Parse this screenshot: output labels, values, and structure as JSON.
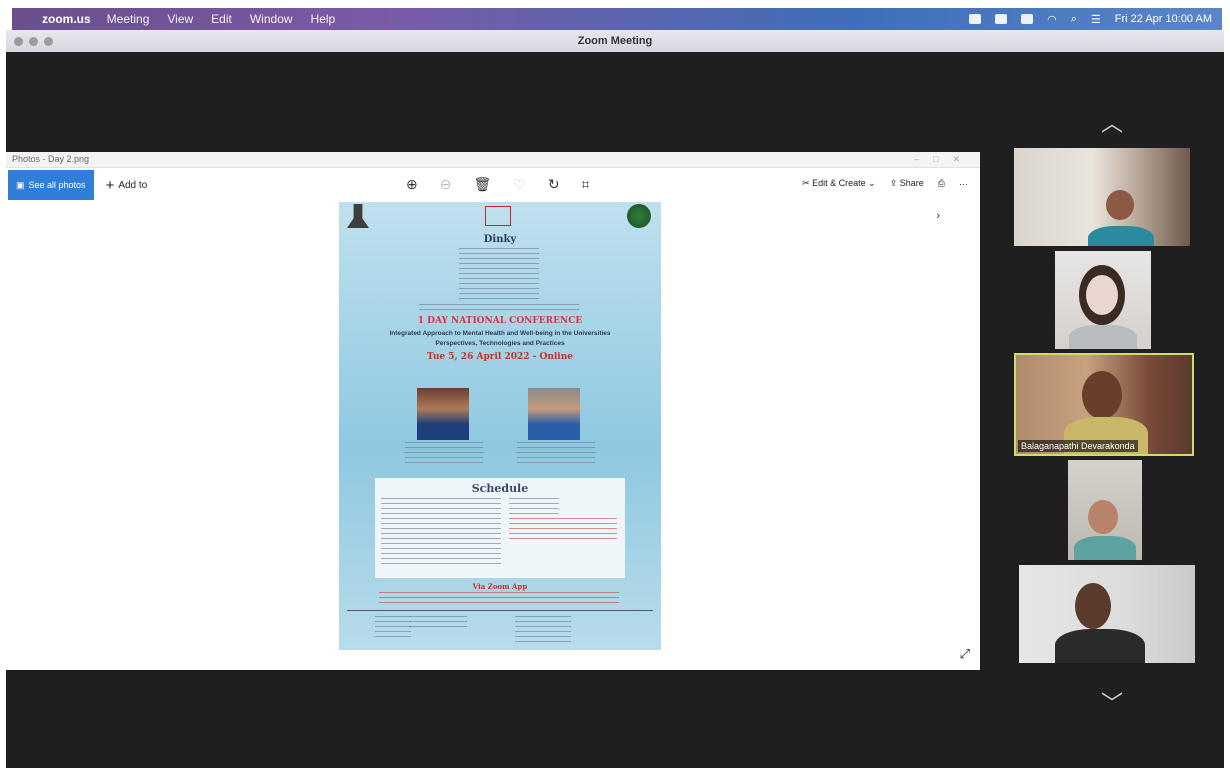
{
  "menubar": {
    "app_name": "zoom.us",
    "items": [
      "Meeting",
      "View",
      "Edit",
      "Window",
      "Help"
    ],
    "clock": "Fri 22 Apr  10:00 AM"
  },
  "window": {
    "title": "Zoom Meeting"
  },
  "photos": {
    "window_title": "Photos - Day 2.png",
    "see_all_label": "See all photos",
    "add_to_label": "Add to",
    "edit_create_label": "Edit & Create",
    "share_label": "Share",
    "more_label": "···"
  },
  "poster": {
    "lines": [
      "Dinky",
      "1 DAY NATIONAL CONFERENCE",
      "Integrated Approach to Mental Health and Well-being in the Universities",
      "Perspectives, Technologies and Practices",
      "Tue 5, 26 April 2022 - Online",
      "Schedule",
      "Via Zoom App"
    ]
  },
  "participants": [
    {
      "name": ""
    },
    {
      "name": ""
    },
    {
      "name": "Balaganapathi Devarakonda"
    },
    {
      "name": ""
    },
    {
      "name": ""
    }
  ],
  "colors": {
    "accent": "#2f7fd8",
    "active_speaker_border": "#c8e06a"
  }
}
